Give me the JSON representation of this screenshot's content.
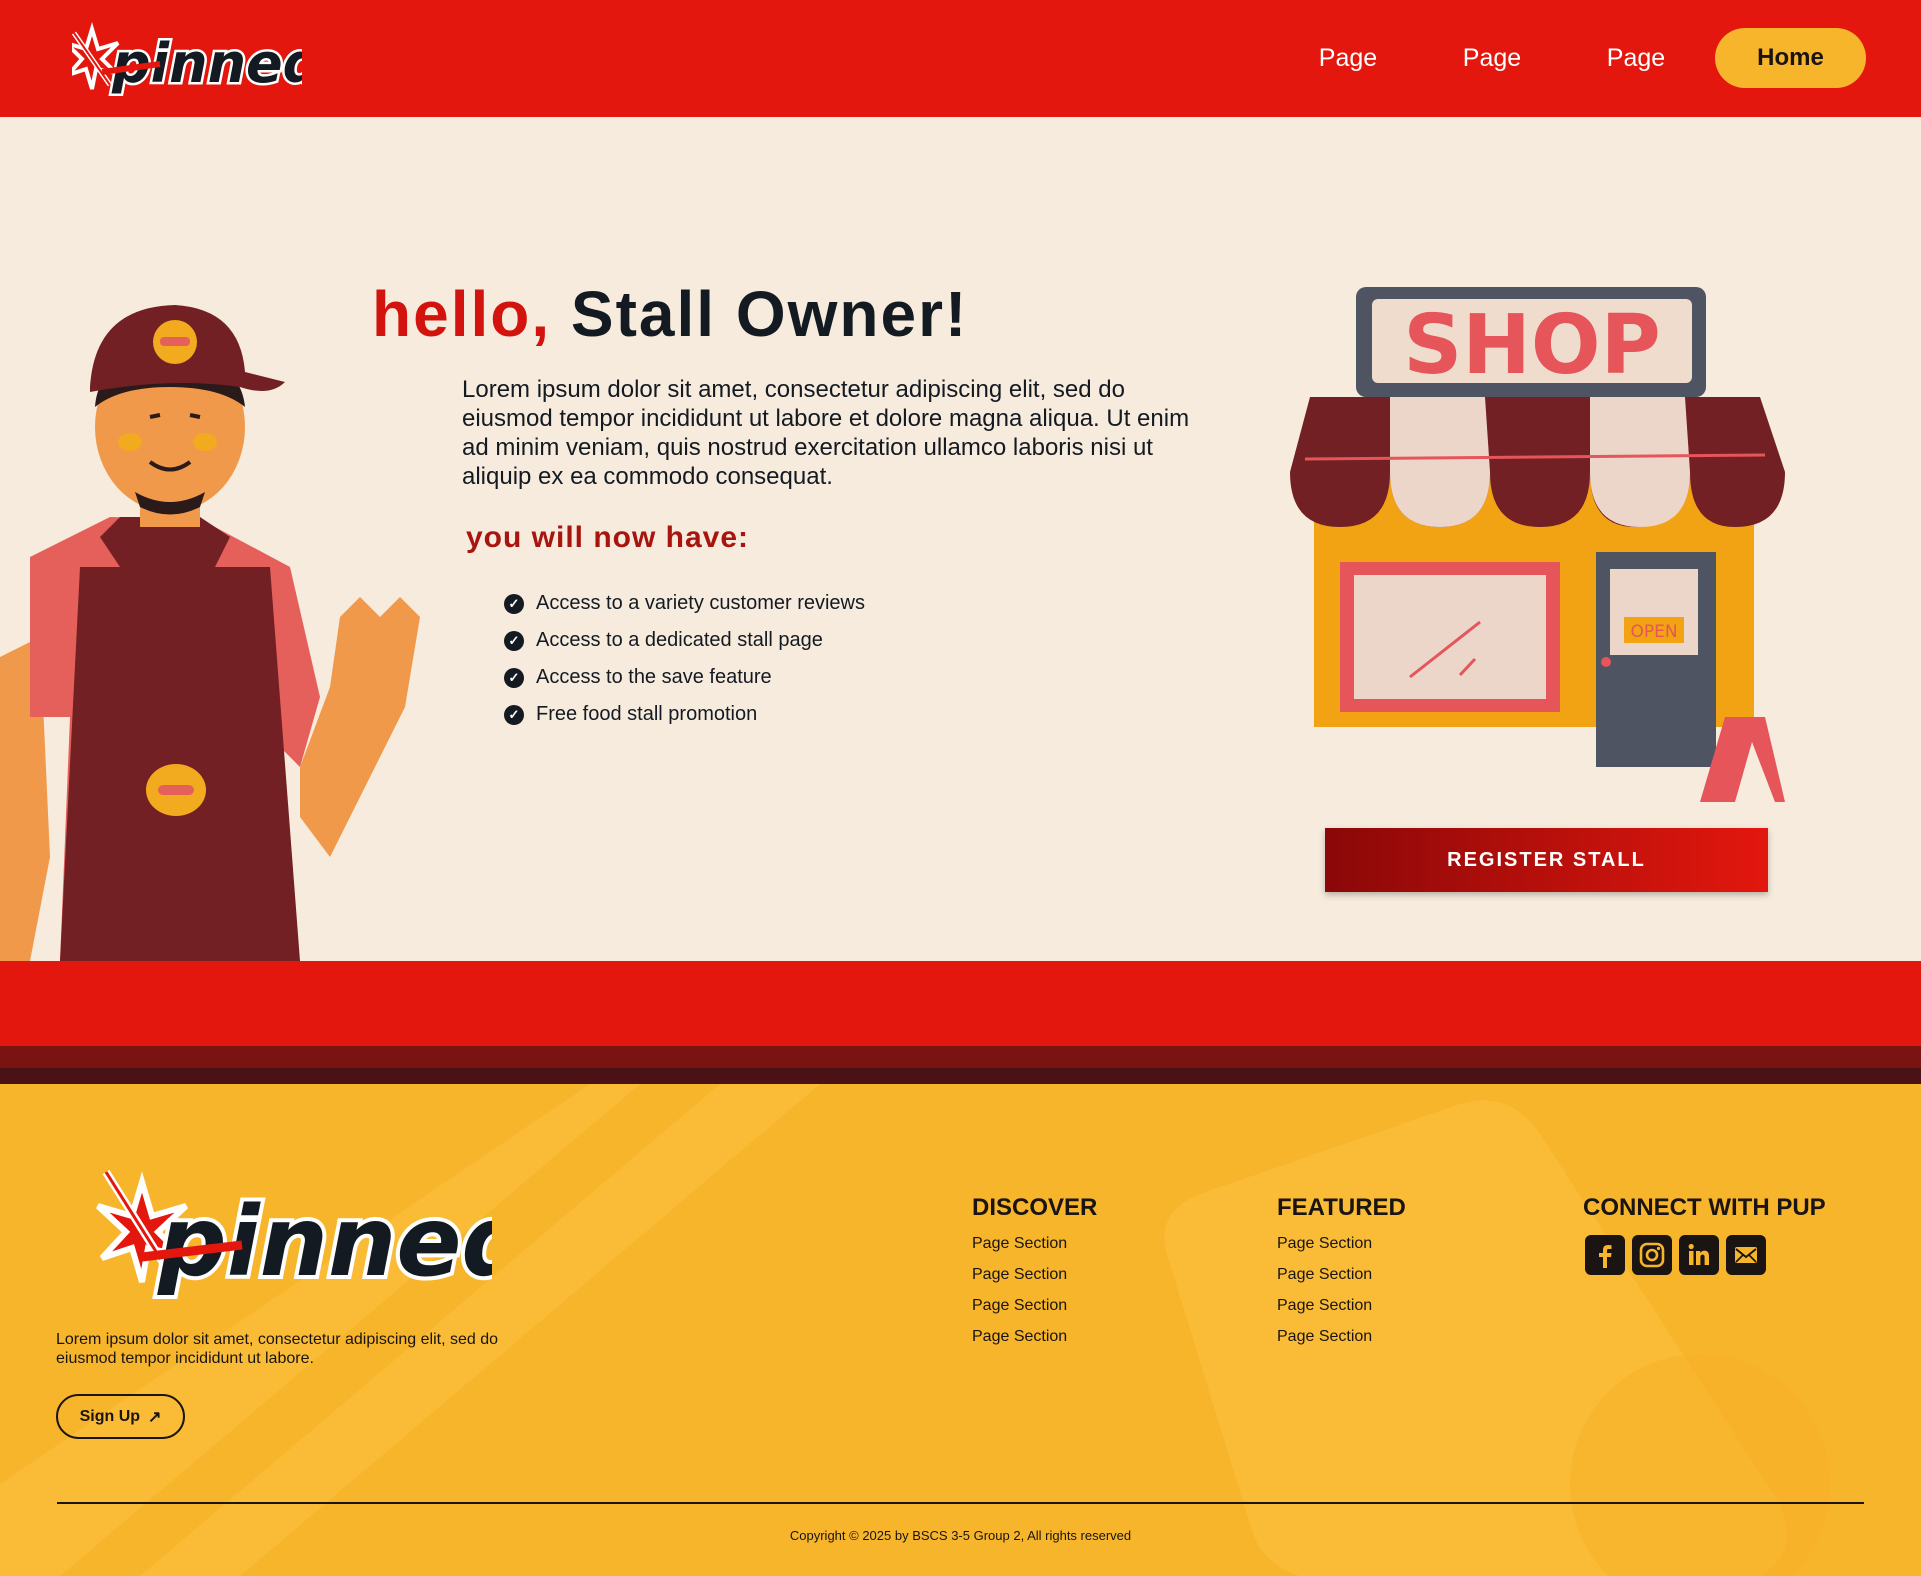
{
  "nav": {
    "logo_text": "pinned",
    "links": [
      "Page",
      "Page",
      "Page"
    ],
    "home_label": "Home"
  },
  "hero": {
    "title_hello": "hello,",
    "title_rest": "Stall Owner!",
    "body": "Lorem ipsum dolor sit amet, consectetur adipiscing elit, sed do eiusmod tempor incididunt ut labore et dolore magna aliqua. Ut enim ad minim veniam, quis nostrud exercitation ullamco laboris nisi ut aliquip ex ea commodo consequat.",
    "subheading": "you will now have:",
    "benefits": [
      "Access to a variety customer reviews",
      "Access to a dedicated stall page",
      "Access to the save feature",
      "Free food stall promotion"
    ],
    "shop_sign": "SHOP",
    "open_sign": "OPEN",
    "register_label": "REGISTER STALL"
  },
  "footer": {
    "logo_text": "pinned",
    "description": "Lorem ipsum dolor sit amet, consectetur adipiscing elit, sed do eiusmod tempor incididunt ut labore.",
    "signup_label": "Sign Up",
    "discover": {
      "heading": "DISCOVER",
      "links": [
        "Page Section",
        "Page Section",
        "Page Section",
        "Page Section"
      ]
    },
    "featured": {
      "heading": "FEATURED",
      "links": [
        "Page Section",
        "Page Section",
        "Page Section",
        "Page Section"
      ]
    },
    "connect": {
      "heading": "CONNECT WITH PUP",
      "socials": [
        "facebook-icon",
        "instagram-icon",
        "linkedin-icon",
        "mail-icon"
      ]
    },
    "copyright": "Copyright  © 2025 by BSCS 3-5 Group 2, All rights reserved"
  },
  "colors": {
    "brand_red": "#e3170e",
    "brand_yellow": "#f7b52c",
    "cream": "#f6ebdd",
    "dark": "#141a22",
    "maroon": "#7a1412"
  }
}
